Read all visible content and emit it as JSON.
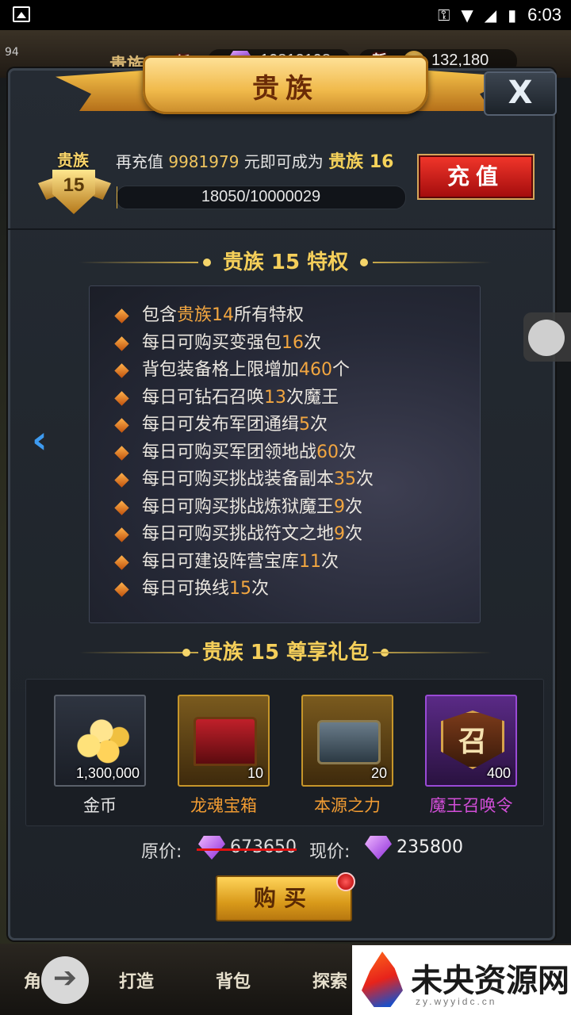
{
  "status_bar": {
    "time": "6:03",
    "icons": [
      "image-icon",
      "key-icon",
      "wifi-icon",
      "signal-icon",
      "battery-icon"
    ]
  },
  "hud": {
    "level": "94",
    "title_prefix": "贵族1",
    "new_tag": "新",
    "gems": "10812198",
    "coins": "132,180"
  },
  "dialog": {
    "title": "贵族",
    "close_label": "X",
    "badge_label": "贵族",
    "badge_level": "15",
    "recharge_text": {
      "prefix": "再充值 ",
      "amount": "9981979",
      "mid": " 元即可成为 ",
      "target": "贵族 16"
    },
    "progress": {
      "text": "18050/10000029",
      "current": 18050,
      "total": 10000029
    },
    "recharge_button": "充值",
    "privileges_title": "贵族 15 特权",
    "privileges": [
      {
        "pre": "包含",
        "hl": "贵族14",
        "post": "所有特权"
      },
      {
        "pre": "每日可购买变强包",
        "hl": "16",
        "post": "次"
      },
      {
        "pre": "背包装备格上限增加",
        "hl": "460",
        "post": "个"
      },
      {
        "pre": "每日可钻石召唤",
        "hl": "13",
        "post": "次魔王"
      },
      {
        "pre": "每日可发布军团通缉",
        "hl": "5",
        "post": "次"
      },
      {
        "pre": "每日可购买军团领地战",
        "hl": "60",
        "post": "次"
      },
      {
        "pre": "每日可购买挑战装备副本",
        "hl": "35",
        "post": "次"
      },
      {
        "pre": "每日可购买挑战炼狱魔王",
        "hl": "9",
        "post": "次"
      },
      {
        "pre": "每日可购买挑战符文之地",
        "hl": "9",
        "post": "次"
      },
      {
        "pre": "每日可建设阵营宝库",
        "hl": "11",
        "post": "次"
      },
      {
        "pre": "每日可换线",
        "hl": "15",
        "post": "次"
      }
    ],
    "gift_title": "贵族 15 尊享礼包",
    "gifts": [
      {
        "name": "金币",
        "count": "1,300,000",
        "icon": "gold-coins-icon"
      },
      {
        "name": "龙魂宝箱",
        "count": "10",
        "icon": "dragon-chest-icon"
      },
      {
        "name": "本源之力",
        "count": "20",
        "icon": "origin-chest-icon"
      },
      {
        "name": "魔王召唤令",
        "count": "400",
        "icon": "summon-seal-icon"
      }
    ],
    "summon_glyph": "召",
    "original_price_label": "原价:",
    "original_price": "673650",
    "current_price_label": "现价:",
    "current_price": "235800",
    "buy_button": "购买"
  },
  "bottom_nav": [
    "角色",
    "打造",
    "背包",
    "探索"
  ],
  "watermark": {
    "text": "未央资源网",
    "url": "zy.wyyidc.cn"
  },
  "colors": {
    "accent_gold": "#f5cf5a",
    "highlight_orange": "#f2a640",
    "recharge_red": "#d01a1a",
    "summon_purple": "#d24ed8"
  }
}
